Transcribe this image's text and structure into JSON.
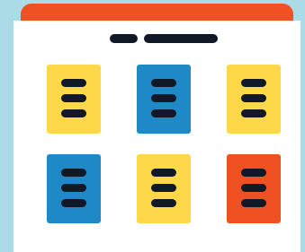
{
  "colors": {
    "background": "#acdbe8",
    "window_bg": "#ffffff",
    "titlebar": "#ef5122",
    "header_bar": "#111827",
    "card_line": "#111827",
    "yellow": "#fed849",
    "blue": "#1e89c6",
    "orange": "#ef5122"
  },
  "header": {
    "bars": [
      "short-bar",
      "long-bar"
    ]
  },
  "cards": [
    {
      "name": "card-yellow-1",
      "color": "yellow",
      "lines": 3
    },
    {
      "name": "card-blue-1",
      "color": "blue",
      "lines": 3
    },
    {
      "name": "card-yellow-2",
      "color": "yellow",
      "lines": 3
    },
    {
      "name": "card-blue-2",
      "color": "blue",
      "lines": 3
    },
    {
      "name": "card-yellow-3",
      "color": "yellow",
      "lines": 3
    },
    {
      "name": "card-orange-1",
      "color": "orange",
      "lines": 3
    }
  ]
}
